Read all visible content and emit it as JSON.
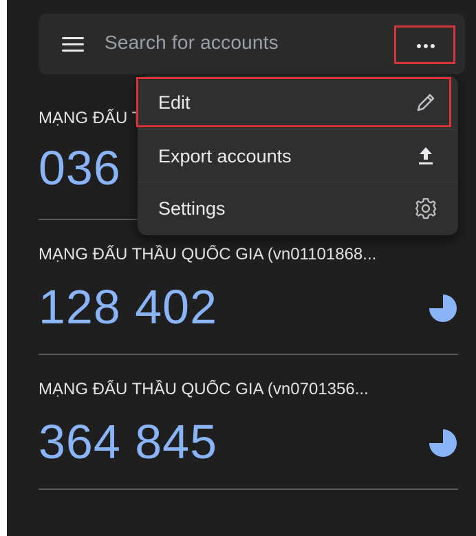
{
  "search": {
    "placeholder": "Search for accounts"
  },
  "menu": {
    "items": [
      {
        "label": "Edit",
        "icon": "pencil-icon"
      },
      {
        "label": "Export accounts",
        "icon": "upload-icon"
      },
      {
        "label": "Settings",
        "icon": "gear-icon"
      }
    ]
  },
  "accounts": [
    {
      "name": "MẠNG ĐẤU THẦU QUỐC GIA",
      "code": "036 ",
      "timer_fraction_remaining": 0.75
    },
    {
      "name": "MẠNG ĐẤU THẦU QUỐC GIA (vn01101868...",
      "code": "128 402",
      "timer_fraction_remaining": 0.75
    },
    {
      "name": "MẠNG ĐẤU THẦU QUỐC GIA (vn0701356...",
      "code": "364 845",
      "timer_fraction_remaining": 0.75
    }
  ],
  "colors": {
    "background": "#1f1f1f",
    "surface": "#2b2b2b",
    "menu_surface": "#2f2f2f",
    "code_accent": "#8ab4f8",
    "highlight": "#d9333a"
  }
}
